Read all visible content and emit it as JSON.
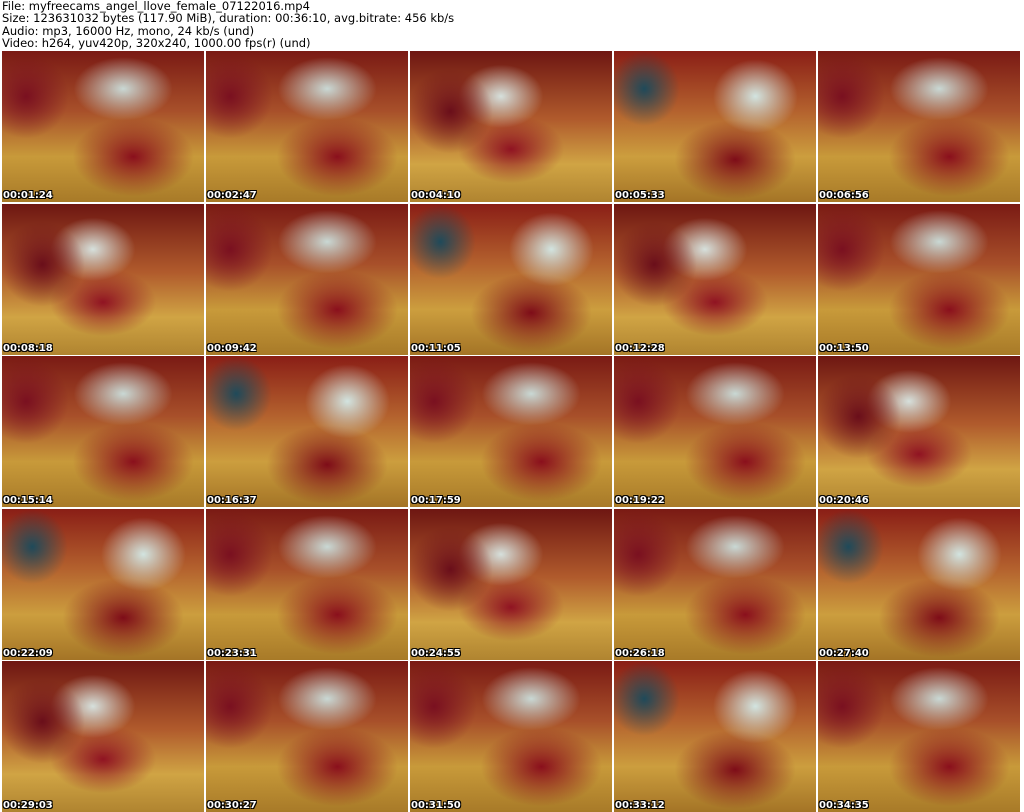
{
  "info": {
    "file": "File: myfreecams_angel_llove_female_07122016.mp4",
    "size": "Size: 123631032 bytes (117.90 MiB), duration: 00:36:10, avg.bitrate: 456 kb/s",
    "audio": "Audio: mp3, 16000 Hz, mono, 24 kb/s (und)",
    "video": "Video: h264, yuv420p, 320x240, 1000.00 fps(r) (und)"
  },
  "thumbnails": [
    {
      "time": "00:01:24"
    },
    {
      "time": "00:02:47"
    },
    {
      "time": "00:04:10"
    },
    {
      "time": "00:05:33"
    },
    {
      "time": "00:06:56"
    },
    {
      "time": "00:08:18"
    },
    {
      "time": "00:09:42"
    },
    {
      "time": "00:11:05"
    },
    {
      "time": "00:12:28"
    },
    {
      "time": "00:13:50"
    },
    {
      "time": "00:15:14"
    },
    {
      "time": "00:16:37"
    },
    {
      "time": "00:17:59"
    },
    {
      "time": "00:19:22"
    },
    {
      "time": "00:20:46"
    },
    {
      "time": "00:22:09"
    },
    {
      "time": "00:23:31"
    },
    {
      "time": "00:24:55"
    },
    {
      "time": "00:26:18"
    },
    {
      "time": "00:27:40"
    },
    {
      "time": "00:29:03"
    },
    {
      "time": "00:30:27"
    },
    {
      "time": "00:31:50"
    },
    {
      "time": "00:33:12"
    },
    {
      "time": "00:34:35"
    }
  ]
}
